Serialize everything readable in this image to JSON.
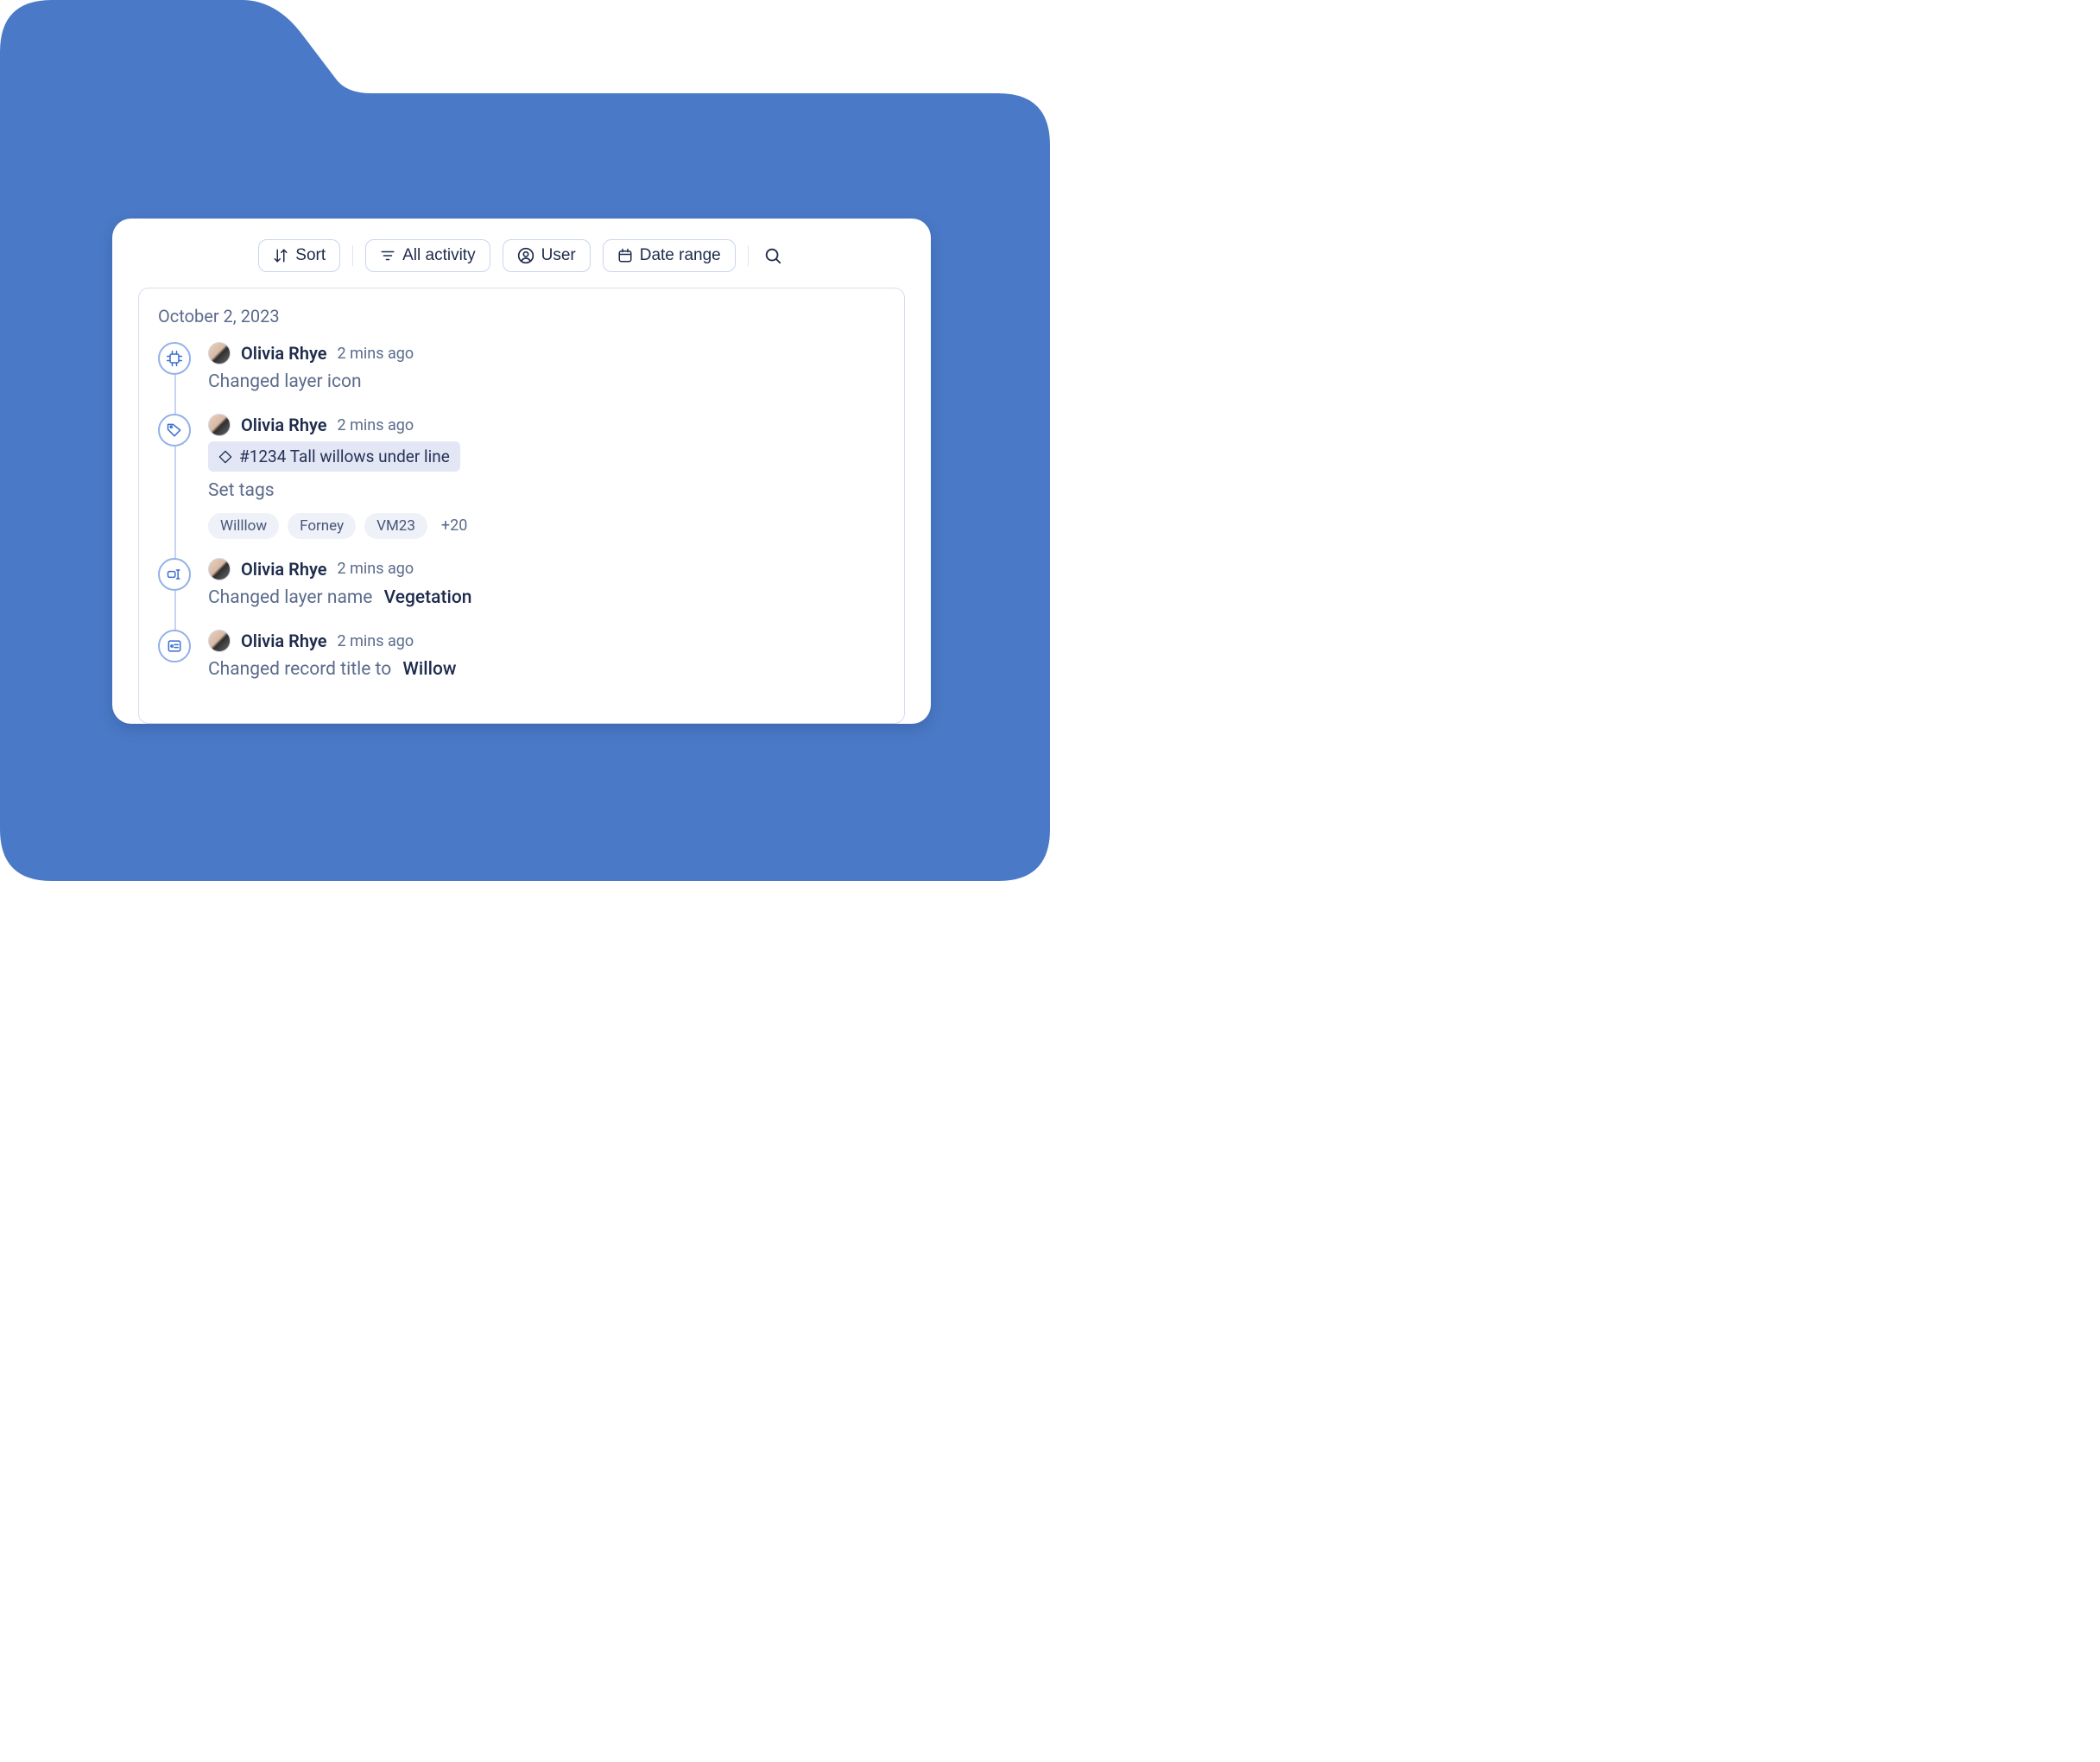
{
  "filters": {
    "sort_label": "Sort",
    "activity_label": "All activity",
    "user_label": "User",
    "date_label": "Date range"
  },
  "feed": {
    "date": "October 2, 2023",
    "items": [
      {
        "user": "Olivia Rhye",
        "time": "2 mins ago",
        "description": "Changed layer icon"
      },
      {
        "user": "Olivia Rhye",
        "time": "2 mins ago",
        "object_ref": "#1234 Tall willows under line",
        "description": "Set tags",
        "tags": [
          "Willlow",
          "Forney",
          "VM23"
        ],
        "tags_more": "+20"
      },
      {
        "user": "Olivia Rhye",
        "time": "2 mins ago",
        "description": "Changed layer name",
        "value": "Vegetation"
      },
      {
        "user": "Olivia Rhye",
        "time": "2 mins ago",
        "description": "Changed record title to",
        "value": "Willow"
      }
    ]
  }
}
